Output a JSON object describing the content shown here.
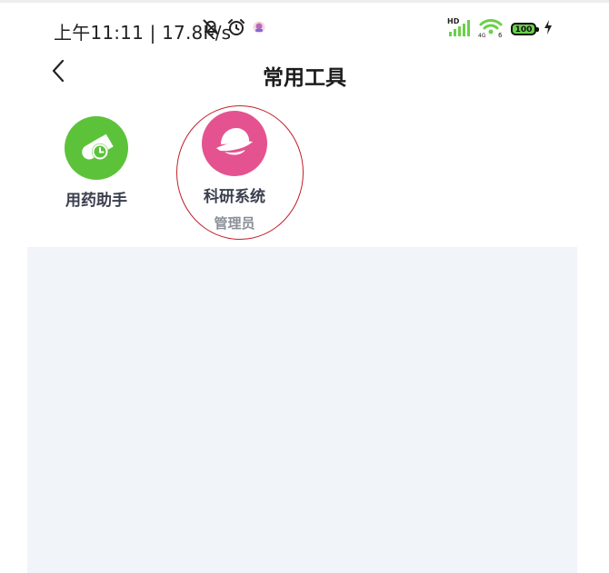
{
  "status_bar": {
    "time_speed": "上午11:11 | 17.8K/s",
    "icons_left": [
      "bell-off-icon",
      "alarm-icon",
      "app-notification-icon"
    ],
    "icons_right": [
      "hd-signal-icon",
      "wifi-icon",
      "battery-icon",
      "charging-icon"
    ],
    "battery_level": "100",
    "hd_label": "HD",
    "network_label": "4G",
    "wifi_label": "6"
  },
  "nav": {
    "title": "常用工具",
    "back_icon": "chevron-left-icon"
  },
  "tools": [
    {
      "label": "用药助手",
      "sublabel": "",
      "icon": "pill-clock-icon",
      "color": "#5cc23a"
    },
    {
      "label": "科研系统",
      "sublabel": "管理员",
      "icon": "planet-icon",
      "color": "#e4538f"
    }
  ],
  "colors": {
    "panel_background": "#f1f4f9",
    "highlight_ring": "#c0202a",
    "battery_fill": "#6ad04a",
    "signal": "#6ad04a"
  }
}
